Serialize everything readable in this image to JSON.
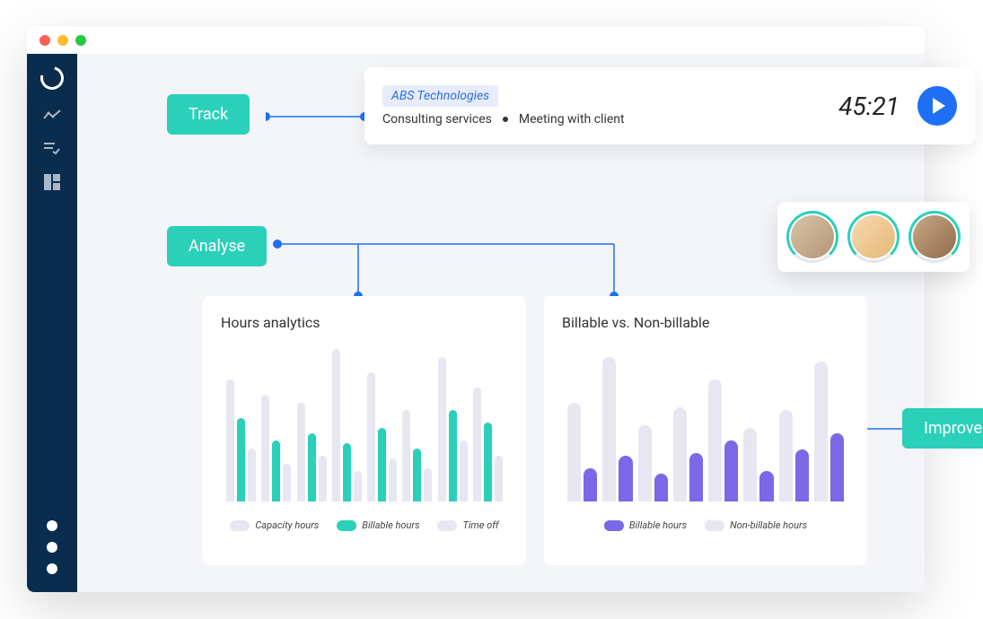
{
  "tags": {
    "track": "Track",
    "analyse": "Analyse",
    "improve": "Improve"
  },
  "tracker": {
    "client": "ABS Technologies",
    "service": "Consulting services",
    "task": "Meeting with client",
    "timer": "45:21"
  },
  "charts": {
    "hours": {
      "title": "Hours analytics",
      "legend": {
        "capacity": "Capacity hours",
        "billable": "Billable hours",
        "timeoff": "Time off"
      }
    },
    "billable": {
      "title": "Billable vs. Non-billable",
      "legend": {
        "billable": "Billable hours",
        "nonbillable": "Non-billable hours"
      }
    }
  },
  "colors": {
    "teal": "#2bd0b9",
    "purple": "#7a68e6",
    "lightGrey": "#e6e7f1",
    "blue": "#1f6ff5"
  },
  "chart_data": [
    {
      "type": "bar",
      "title": "Hours analytics",
      "series": [
        {
          "name": "Capacity hours",
          "color": "#e6e7f1",
          "values": [
            80,
            70,
            65,
            100,
            85,
            60,
            95,
            75
          ]
        },
        {
          "name": "Billable hours",
          "color": "#2bd0b9",
          "values": [
            55,
            40,
            45,
            38,
            48,
            35,
            60,
            52
          ]
        },
        {
          "name": "Time off",
          "color": "#e6e7f1",
          "values": [
            35,
            25,
            30,
            20,
            28,
            22,
            40,
            30
          ]
        }
      ],
      "ylim": [
        0,
        100
      ]
    },
    {
      "type": "bar",
      "title": "Billable vs. Non-billable",
      "series": [
        {
          "name": "Non-billable hours",
          "color": "#e6e7f1",
          "values": [
            65,
            95,
            50,
            62,
            80,
            48,
            60,
            92
          ]
        },
        {
          "name": "Billable hours",
          "color": "#7a68e6",
          "values": [
            22,
            30,
            18,
            32,
            40,
            20,
            34,
            45
          ]
        }
      ],
      "ylim": [
        0,
        100
      ]
    }
  ]
}
